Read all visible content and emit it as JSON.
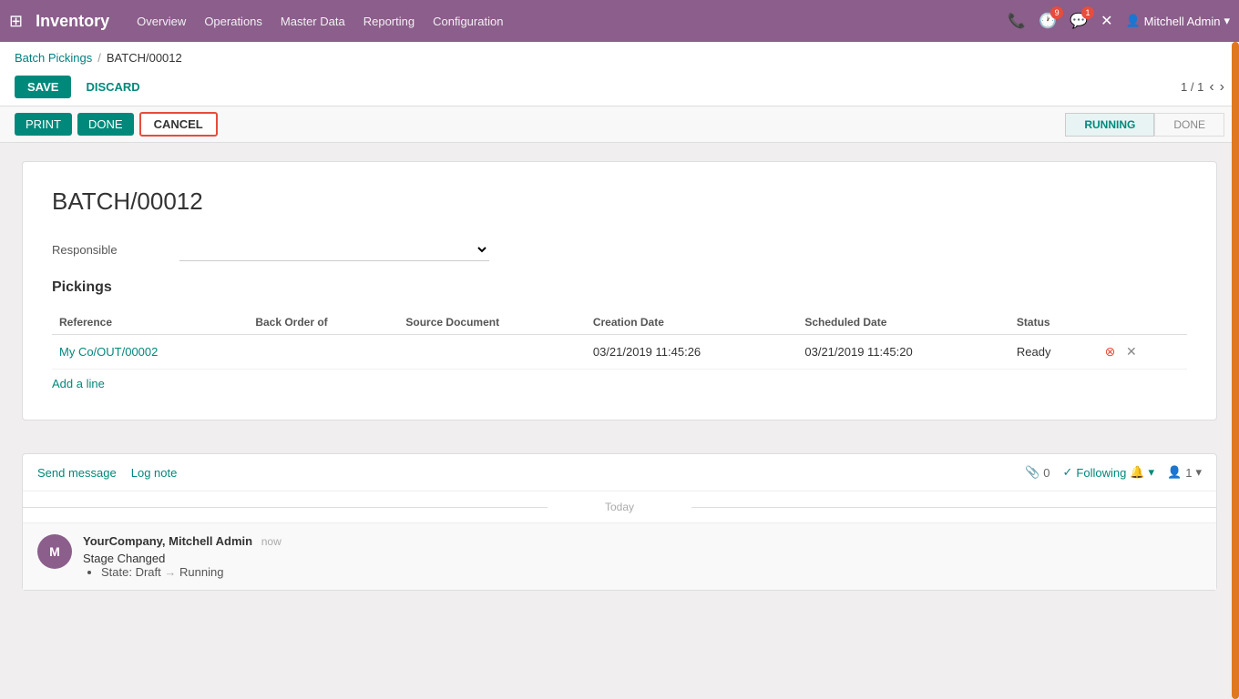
{
  "topbar": {
    "app_title": "Inventory",
    "nav_items": [
      "Overview",
      "Operations",
      "Master Data",
      "Reporting",
      "Configuration"
    ],
    "notification_count": "9",
    "message_count": "1",
    "user": "Mitchell Admin"
  },
  "breadcrumb": {
    "parent_label": "Batch Pickings",
    "separator": "/",
    "current": "BATCH/00012"
  },
  "toolbar": {
    "save_label": "SAVE",
    "discard_label": "DISCARD",
    "pager": "1 / 1"
  },
  "secondary_toolbar": {
    "print_label": "PRINT",
    "done_label": "DONE",
    "cancel_label": "CANCEL"
  },
  "status_pipeline": {
    "steps": [
      "RUNNING",
      "DONE"
    ],
    "active": "RUNNING"
  },
  "record": {
    "title": "BATCH/00012",
    "responsible_label": "Responsible",
    "responsible_placeholder": ""
  },
  "pickings": {
    "section_title": "Pickings",
    "columns": [
      "Reference",
      "Back Order of",
      "Source Document",
      "Creation Date",
      "Scheduled Date",
      "Status"
    ],
    "rows": [
      {
        "reference": "My Co/OUT/00002",
        "back_order_of": "",
        "source_document": "",
        "creation_date": "03/21/2019 11:45:26",
        "scheduled_date": "03/21/2019 11:45:20",
        "status": "Ready"
      }
    ],
    "add_line_label": "Add a line"
  },
  "chatter": {
    "send_message_label": "Send message",
    "log_note_label": "Log note",
    "attachments_count": "0",
    "following_label": "Following",
    "people_count": "1",
    "today_label": "Today",
    "messages": [
      {
        "author": "YourCompany, Mitchell Admin",
        "time": "now",
        "text": "Stage Changed",
        "detail": "State: Draft → Running"
      }
    ]
  }
}
